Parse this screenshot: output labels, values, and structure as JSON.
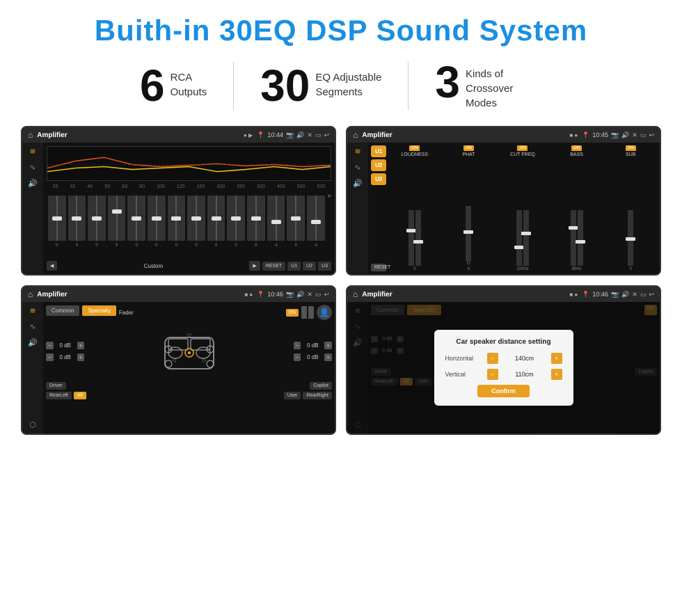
{
  "page": {
    "title": "Buith-in 30EQ DSP Sound System",
    "stats": [
      {
        "number": "6",
        "label": "RCA\nOutputs"
      },
      {
        "number": "30",
        "label": "EQ Adjustable\nSegments"
      },
      {
        "number": "3",
        "label": "Kinds of\nCrossover Modes"
      }
    ]
  },
  "screenshots": {
    "top_left": {
      "title": "Amplifier",
      "time": "10:44",
      "eq_freqs": [
        "25",
        "32",
        "40",
        "50",
        "63",
        "80",
        "100",
        "125",
        "160",
        "200",
        "250",
        "320",
        "400",
        "500",
        "630"
      ],
      "eq_values": [
        "0",
        "0",
        "0",
        "5",
        "0",
        "0",
        "0",
        "0",
        "0",
        "0",
        "0",
        "-1",
        "0",
        "-1"
      ],
      "preset": "Custom",
      "buttons": [
        "RESET",
        "U1",
        "U2",
        "U3"
      ]
    },
    "top_right": {
      "title": "Amplifier",
      "time": "10:45",
      "presets": [
        "U1",
        "U2",
        "U3"
      ],
      "channels": [
        "LOUDNESS",
        "PHAT",
        "CUT FREQ",
        "BASS",
        "SUB"
      ],
      "reset_label": "RESET"
    },
    "bottom_left": {
      "title": "Amplifier",
      "time": "10:46",
      "tabs": [
        "Common",
        "Specialty"
      ],
      "fader_label": "Fader",
      "fader_on": "ON",
      "db_values": [
        "0 dB",
        "0 dB",
        "0 dB",
        "0 dB"
      ],
      "buttons": [
        "Driver",
        "RearLeft",
        "All",
        "User",
        "RearRight",
        "Copilot"
      ]
    },
    "bottom_right": {
      "title": "Amplifier",
      "time": "10:46",
      "tabs": [
        "Common",
        "Specialty"
      ],
      "dialog": {
        "title": "Car speaker distance setting",
        "horizontal_label": "Horizontal",
        "horizontal_value": "140cm",
        "vertical_label": "Vertical",
        "vertical_value": "110cm",
        "confirm_label": "Confirm"
      },
      "db_values": [
        "0 dB",
        "0 dB"
      ],
      "buttons": [
        "Driver",
        "RearLeft",
        "All",
        "User",
        "RearRight",
        "Copilot"
      ]
    }
  },
  "icons": {
    "home": "⌂",
    "back": "↩",
    "location": "📍",
    "speaker": "🔊",
    "close": "✕",
    "window": "▭",
    "eq_icon": "≋",
    "wave_icon": "∿",
    "arrow_icon": "⟨⟩",
    "expand": "»",
    "play": "▶",
    "prev": "◀",
    "minus": "−",
    "plus": "+"
  }
}
